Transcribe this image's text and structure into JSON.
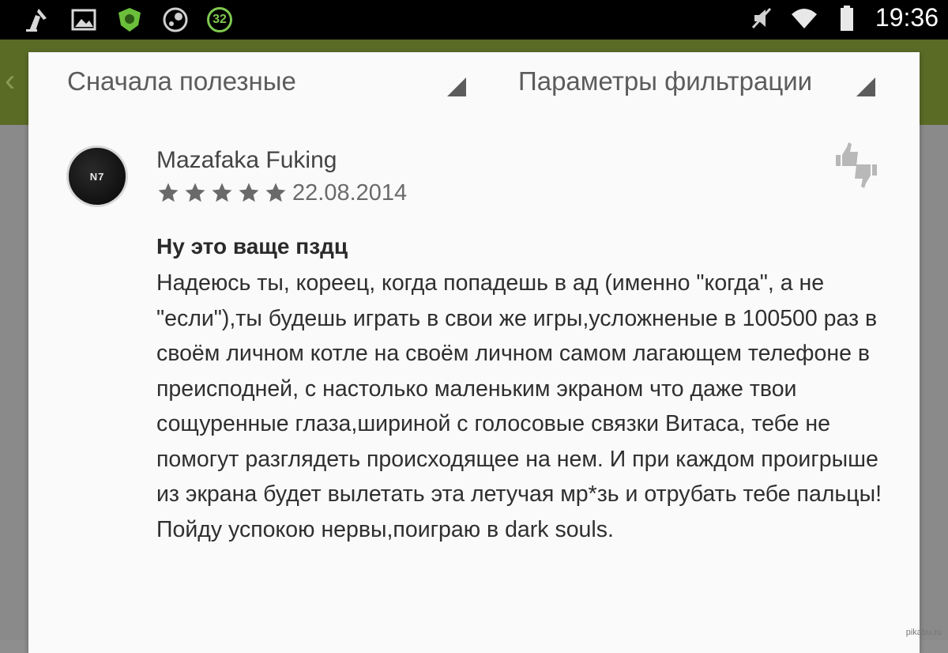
{
  "status_bar": {
    "time": "19:36",
    "notification_count": "32",
    "left_icons": [
      "cleaner-icon",
      "gallery-icon",
      "shield-app-icon",
      "steam-icon",
      "badge-32-icon"
    ],
    "right_icons": [
      "mute-icon",
      "wifi-icon",
      "battery-icon"
    ]
  },
  "toolbar": {
    "back_glyph": "‹"
  },
  "filters": {
    "sort_label": "Сначала полезные",
    "filter_label": "Параметры фильтрации"
  },
  "review": {
    "author": "Mazafaka Fuking",
    "avatar_text": "N7",
    "rating": 5,
    "max_rating": 5,
    "date": "22.08.2014",
    "title": "Ну это ваще пздц",
    "body": "Надеюсь ты, кореец, когда попадешь в ад (именно \"когда\", а не \"если\"),ты будешь играть в свои же игры,усложненые в 100500 раз в своём личном котле на своём личном самом лагающем телефоне в преисподней, с настолько маленьким экраном что даже твои сощуренные глаза,шириной с голосовые связки Витаса, тебе не помогут разглядеть происходящее на нем. И при каждом проигрыше из экрана будет вылетать эта летучая мр*зь и отрубать тебе пальцы! Пойду успокою нервы,поиграю в dark souls."
  },
  "watermark": "pikabu.ru",
  "colors": {
    "appbar": "#5a6b26",
    "card": "#fafafa",
    "badge_green": "#7ec850"
  }
}
